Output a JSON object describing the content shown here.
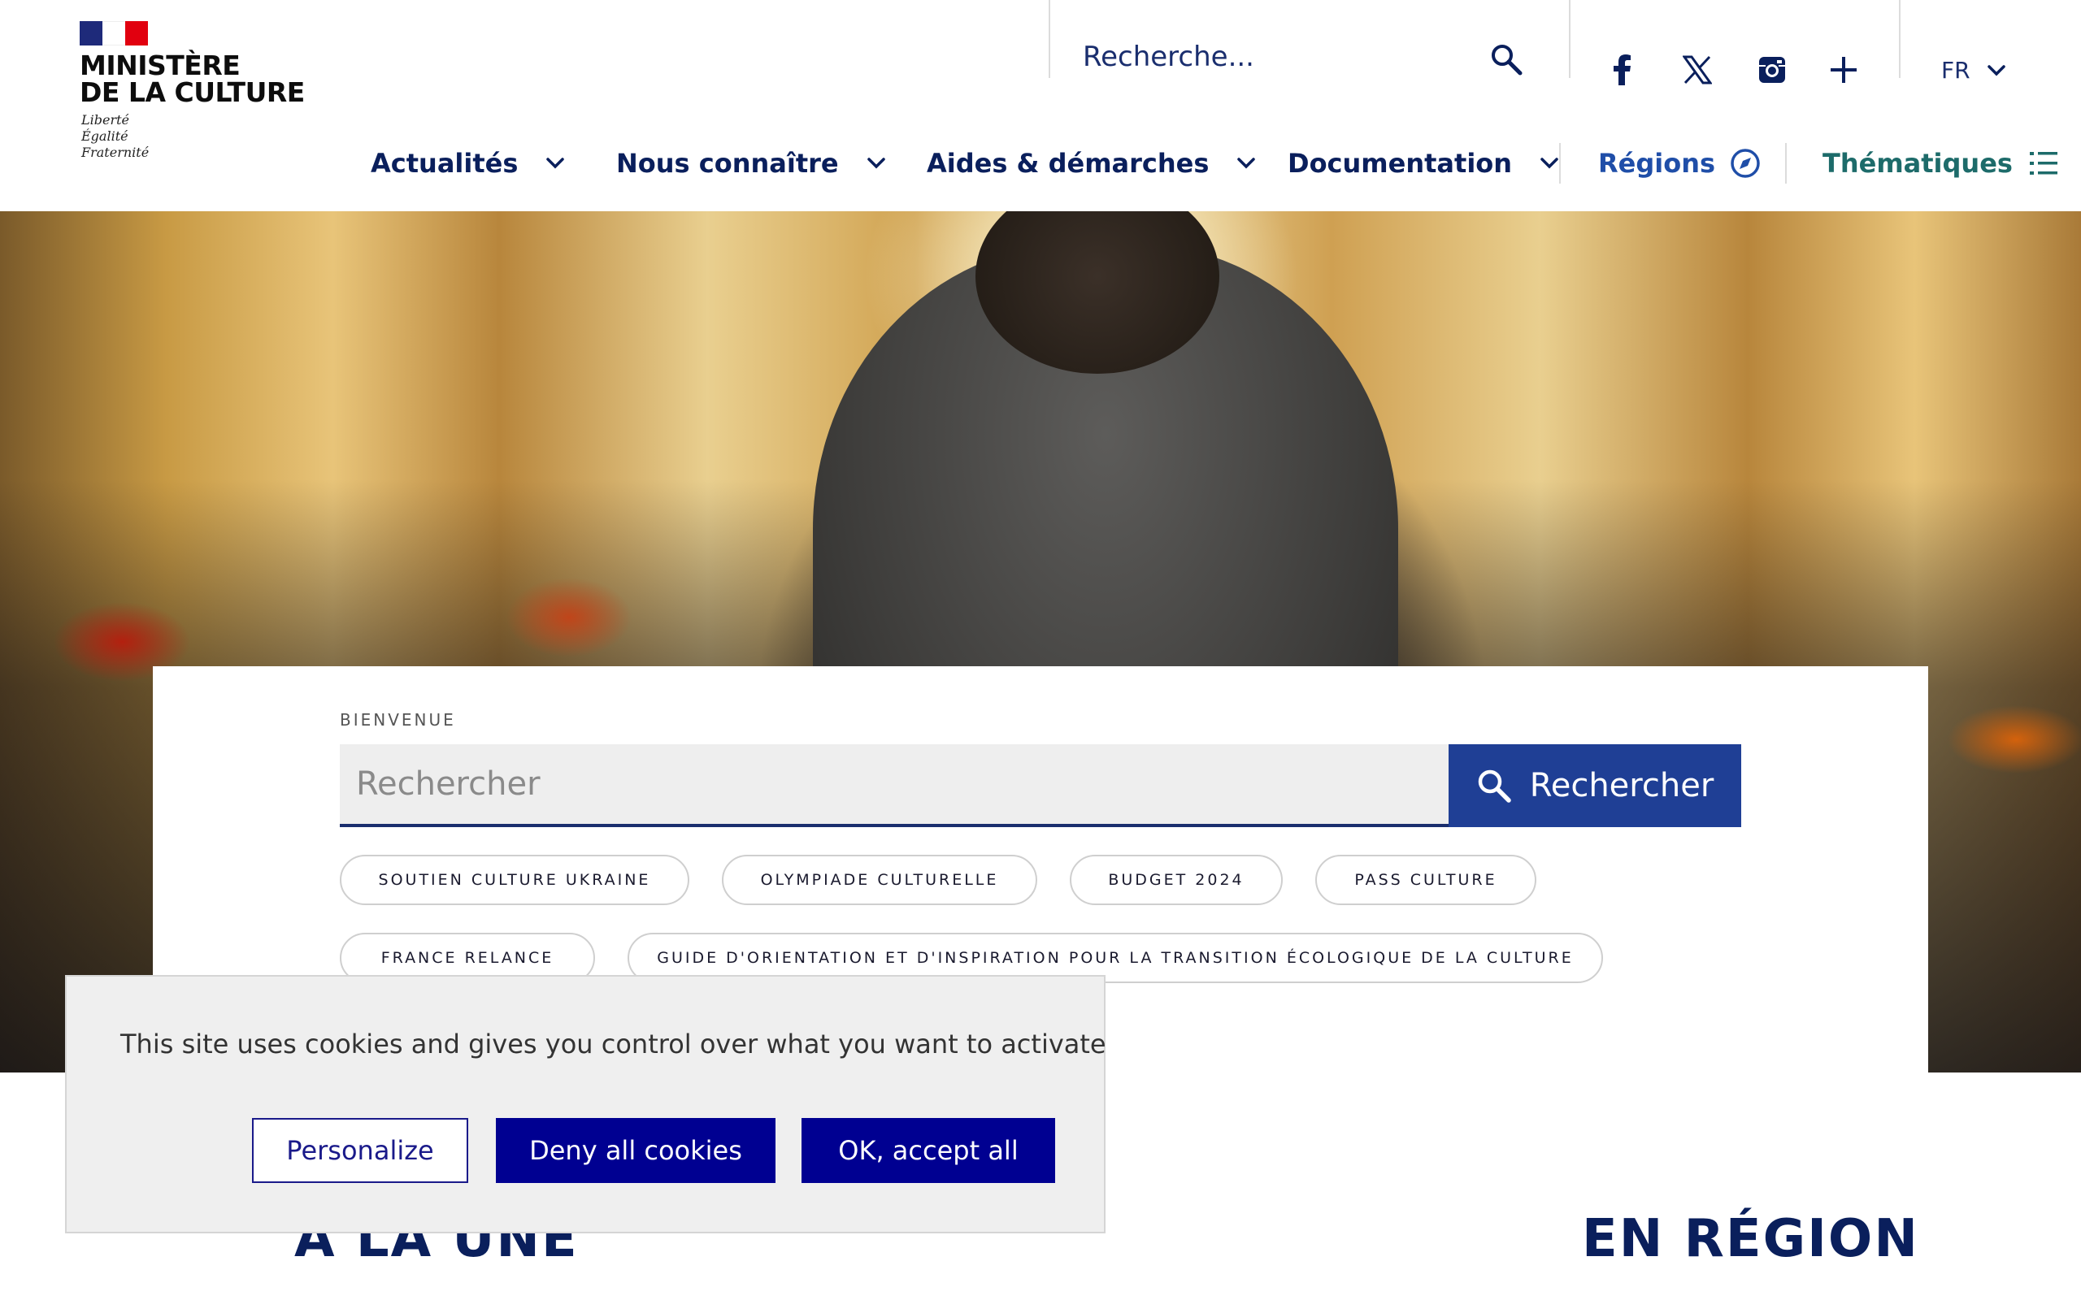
{
  "logo": {
    "title_line1": "MINISTÈRE",
    "title_line2": "DE LA CULTURE",
    "motto": [
      "Liberté",
      "Égalité",
      "Fraternité"
    ]
  },
  "top_bar": {
    "search_text": "Recherche...",
    "search_icon": "search-icon",
    "social_icons": [
      "facebook-icon",
      "x-icon",
      "instagram-icon",
      "plus-icon"
    ],
    "language": "FR"
  },
  "nav": {
    "items": [
      {
        "label": "Actualités",
        "icon": "chevron-down-icon"
      },
      {
        "label": "Nous connaître",
        "icon": "chevron-down-icon"
      },
      {
        "label": "Aides & démarches",
        "icon": "chevron-down-icon"
      },
      {
        "label": "Documentation",
        "icon": "chevron-down-icon"
      },
      {
        "label": "Régions",
        "icon": "compass-icon"
      },
      {
        "label": "Thématiques",
        "icon": "list-icon"
      }
    ]
  },
  "search": {
    "eyebrow": "BIENVENUE",
    "placeholder": "Rechercher",
    "button_label": "Rechercher",
    "chips": [
      "SOUTIEN CULTURE UKRAINE",
      "OLYMPIADE CULTURELLE",
      "BUDGET 2024",
      "PASS CULTURE",
      "FRANCE RELANCE",
      "GUIDE D'ORIENTATION ET D'INSPIRATION POUR LA TRANSITION ÉCOLOGIQUE DE LA CULTURE"
    ]
  },
  "cookie_banner": {
    "message": "This site uses cookies and gives you control over what you want to activate",
    "personalize": "Personalize",
    "deny": "Deny all cookies",
    "accept": "OK, accept all"
  },
  "sections": {
    "a_la_une": "À LA UNE",
    "en_region": "EN RÉGION"
  },
  "colors": {
    "navy": "#0a1f5c",
    "brand_blue": "#1f3f95",
    "cookie_blue": "#000091",
    "flag_red": "#e1000f",
    "regions_blue": "#1f4ea8",
    "themes_teal": "#1d6b6a"
  }
}
